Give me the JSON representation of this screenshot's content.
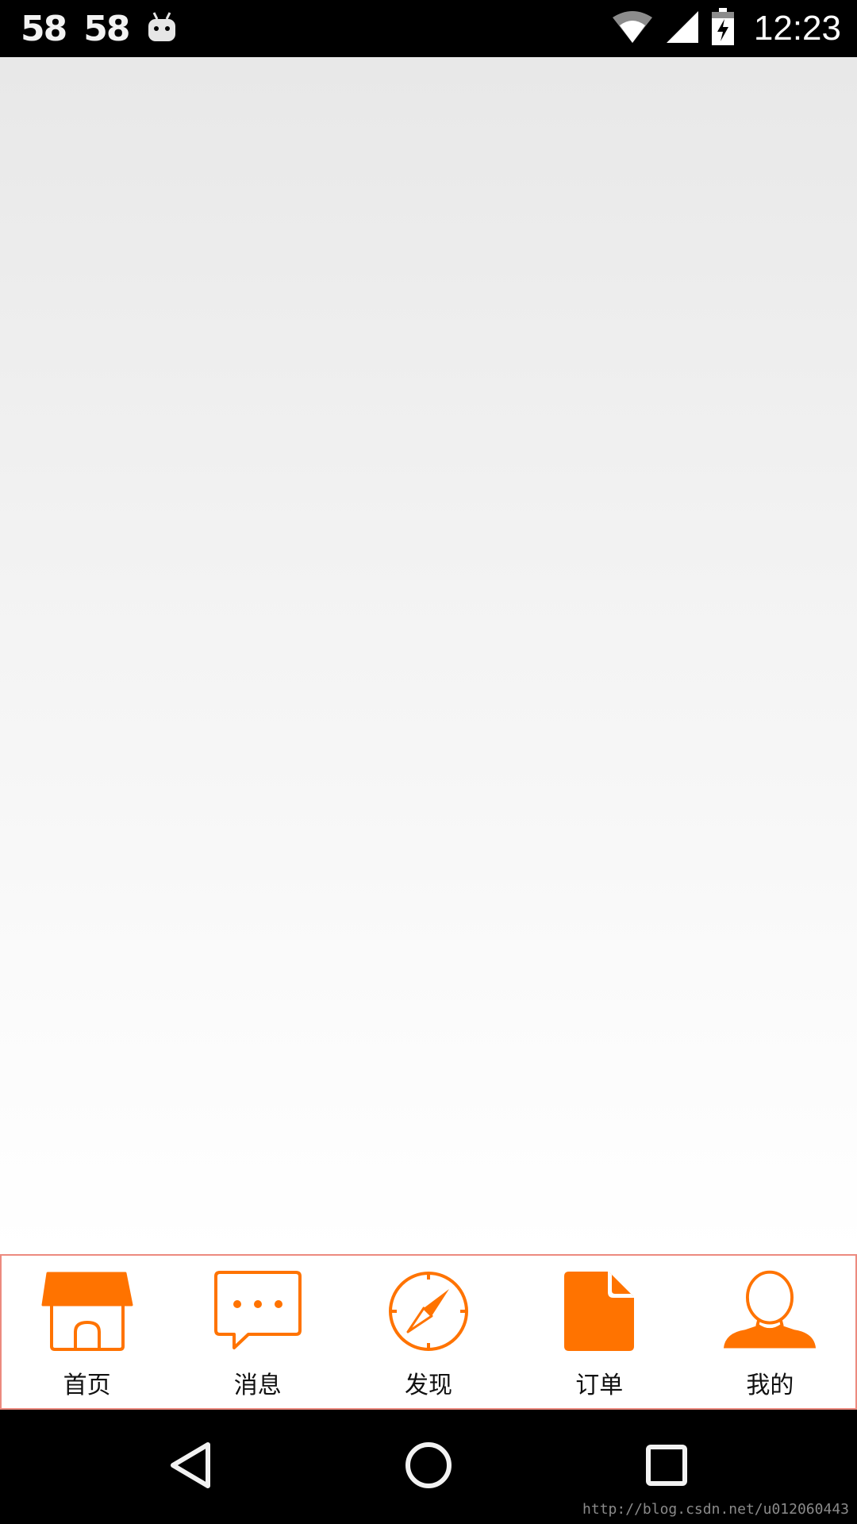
{
  "status_bar": {
    "left_numbers": [
      "58",
      "58"
    ],
    "android_icon": "android-debug-icon",
    "wifi_icon": "wifi-icon",
    "signal_icon": "cell-signal-icon",
    "battery_icon": "battery-charging-icon",
    "time": "12:23"
  },
  "tabs": [
    {
      "label": "首页",
      "icon": "home-store-icon"
    },
    {
      "label": "消息",
      "icon": "message-bubble-icon"
    },
    {
      "label": "发现",
      "icon": "compass-icon"
    },
    {
      "label": "订单",
      "icon": "document-icon"
    },
    {
      "label": "我的",
      "icon": "profile-person-icon"
    }
  ],
  "nav_bar": {
    "back_icon": "back-triangle-icon",
    "home_icon": "home-circle-icon",
    "recents_icon": "recents-square-icon"
  },
  "watermark": "http://blog.csdn.net/u012060443",
  "colors": {
    "accent": "#ff7300",
    "tab_border": "#ec8a7f"
  }
}
